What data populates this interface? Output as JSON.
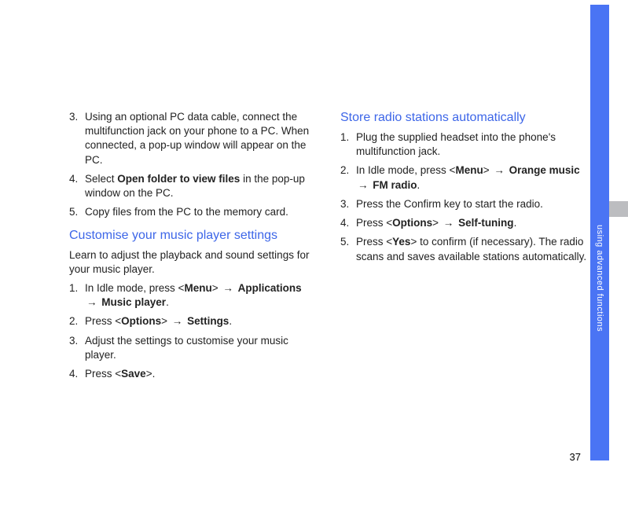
{
  "sidebar": {
    "section_label": "using advanced functions"
  },
  "page_number": "37",
  "left": {
    "steps_a": [
      {
        "n": "3.",
        "before": "Using an optional PC data cable, connect the multifunction jack on your phone to a PC. When connected, a pop-up window will appear on the PC."
      },
      {
        "n": "4.",
        "before": "Select ",
        "bold1": "Open folder to view files",
        "after": " in the pop-up window on the PC."
      },
      {
        "n": "5.",
        "before": "Copy files from the PC to the memory card."
      }
    ],
    "heading": "Customise your music player settings",
    "intro": "Learn to adjust the playback and sound settings for your music player.",
    "steps_b": [
      {
        "n": "1.",
        "before": "In Idle mode, press <",
        "bold1": "Menu",
        "mid1": "> ",
        "arrow1": "→",
        "mid2": " ",
        "bold2": "Applications",
        "mid3": " ",
        "arrow2": "→",
        "mid4": " ",
        "bold3": "Music player",
        "after": "."
      },
      {
        "n": "2.",
        "before": "Press <",
        "bold1": "Options",
        "mid1": "> ",
        "arrow1": "→",
        "mid2": " ",
        "bold2": "Settings",
        "after": "."
      },
      {
        "n": "3.",
        "before": "Adjust the settings to customise your music player."
      },
      {
        "n": "4.",
        "before": "Press <",
        "bold1": "Save",
        "after": ">."
      }
    ]
  },
  "right": {
    "heading": "Store radio stations automatically",
    "steps": [
      {
        "n": "1.",
        "before": "Plug the supplied headset into the phone's multifunction jack."
      },
      {
        "n": "2.",
        "before": "In Idle mode, press <",
        "bold1": "Menu",
        "mid1": "> ",
        "arrow1": "→",
        "mid2": " ",
        "bold2": "Orange music",
        "mid3": " ",
        "arrow2": "→",
        "mid4": " ",
        "bold3": "FM radio",
        "after": "."
      },
      {
        "n": "3.",
        "before": "Press the Confirm key to start the radio."
      },
      {
        "n": "4.",
        "before": "Press <",
        "bold1": "Options",
        "mid1": "> ",
        "arrow1": "→",
        "mid2": " ",
        "bold2": "Self-tuning",
        "after": "."
      },
      {
        "n": "5.",
        "before": "Press <",
        "bold1": "Yes",
        "mid1": "> to confirm (if necessary). The radio scans and saves available stations automatically."
      }
    ]
  }
}
